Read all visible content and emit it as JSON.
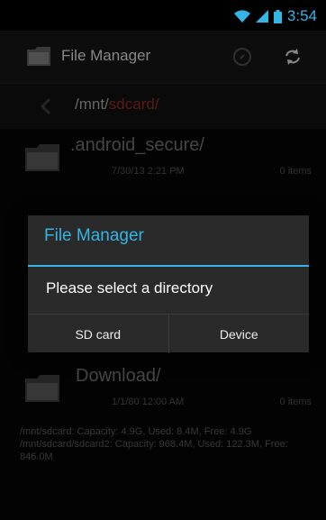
{
  "status_bar": {
    "time": "3:54",
    "icons": [
      "wifi-icon",
      "signal-icon",
      "battery-icon"
    ]
  },
  "action_bar": {
    "title": "File Manager",
    "actions": [
      "compass-icon",
      "refresh-icon"
    ]
  },
  "path": {
    "prefix": "/mnt/",
    "current": "sdcard/"
  },
  "files": [
    {
      "name": ".android_secure/",
      "date": "7/30/13 2:21 PM",
      "count": "0 items"
    },
    {
      "name": "Download/",
      "date": "1/1/80 12:00 AM",
      "count": "0 items"
    }
  ],
  "storage_info": "/mnt/sdcard: Capacity: 4.9G, Used: 8.4M, Free: 4.9G /mnt/sdcard/sdcard2: Capacity: 968.4M, Used: 122.3M, Free: 846.0M",
  "dialog": {
    "title": "File Manager",
    "message": "Please select a directory",
    "buttons": [
      "SD card",
      "Device"
    ]
  },
  "colors": {
    "accent": "#33b5e5",
    "path_accent": "#8a2a1e",
    "dialog_bg": "#2a2a2a"
  }
}
